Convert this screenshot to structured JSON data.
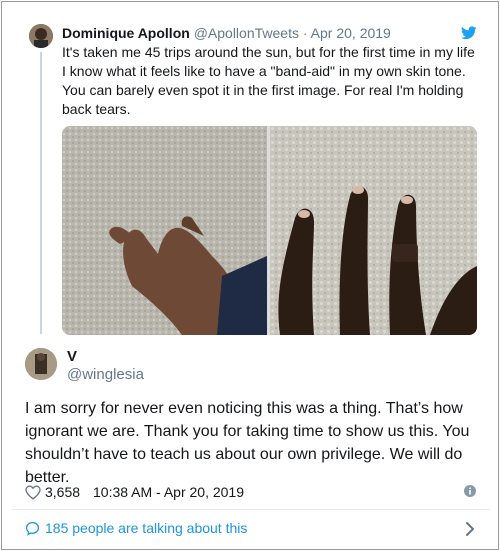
{
  "parent_tweet": {
    "name": "Dominique Apollon",
    "handle": "@ApollonTweets",
    "separator": "·",
    "date": "Apr 20, 2019",
    "text": "It's taken me 45 trips around the sun, but for the first time in my life I know what it feels like to have a \"band-aid\" in my own skin tone. You can barely even spot it in the first image. For real I'm holding back tears.",
    "icons": {
      "platform": "twitter-bird-icon"
    },
    "colors": {
      "brand": "#1da1f2"
    }
  },
  "reply_tweet": {
    "name": "V",
    "handle": "@winglesia",
    "text": "I am sorry for never even noticing this was a thing. That’s how ignorant we are. Thank you for taking time to show us this. You shouldn’t have to teach us about our own privilege. We will do better.",
    "likes": "3,658",
    "timestamp": "10:38 AM - Apr 20, 2019"
  },
  "footer": {
    "talking": "185 people are talking about this",
    "link_color": "#1b95e0"
  }
}
